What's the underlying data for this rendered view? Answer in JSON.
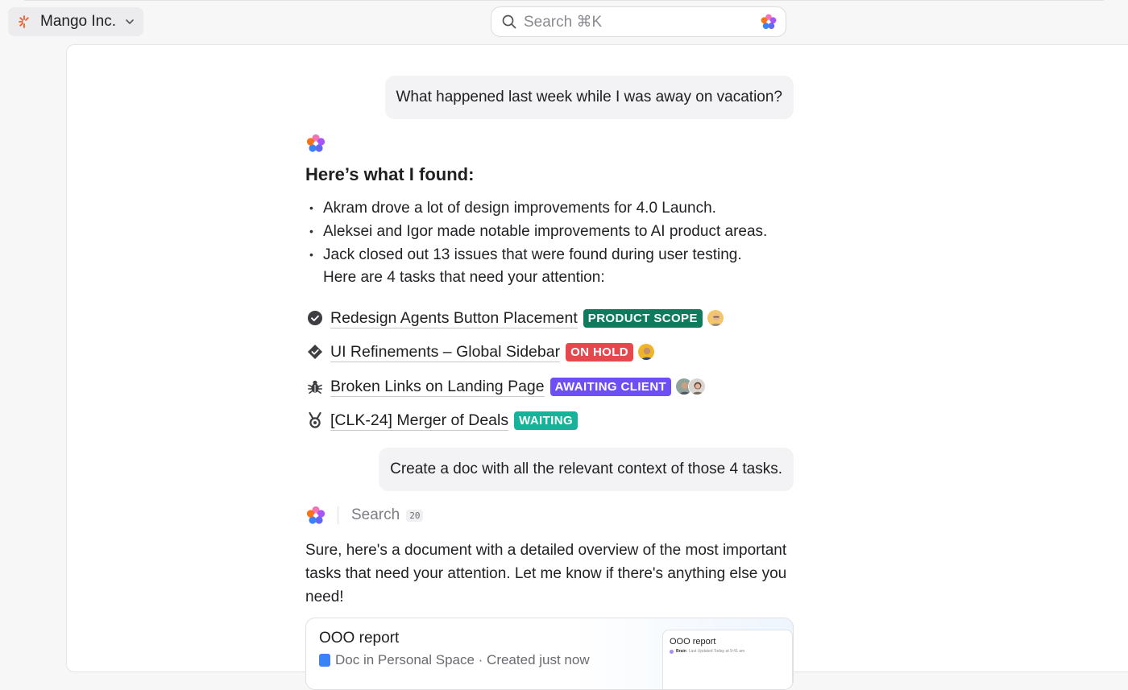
{
  "workspace": {
    "name": "Mango Inc."
  },
  "search": {
    "placeholder": "Search ⌘K"
  },
  "chat": {
    "user_message_1": "What happened last week while I was away on vacation?",
    "ai_heading": "Here’s what I found:",
    "bullets": [
      "Akram drove a lot of design improvements for 4.0 Launch.",
      "Aleksei and Igor made notable improvements to AI product areas.",
      "Jack closed out 13 issues that were found during user testing."
    ],
    "bullets_followup": "Here are 4 tasks that need your attention:",
    "tasks": [
      {
        "name": "Redesign Agents Button Placement",
        "icon": "check-circle-icon",
        "status": "PRODUCT SCOPE",
        "status_color": "#0f7a5c"
      },
      {
        "name": "UI Refinements – Global Sidebar",
        "icon": "diamond-check-icon",
        "status": "ON HOLD",
        "status_color": "#e5484d"
      },
      {
        "name": "Broken Links on Landing Page",
        "icon": "bug-icon",
        "status": "AWAITING CLIENT",
        "status_color": "#6e4ff5"
      },
      {
        "name": "[CLK-24] Merger of Deals",
        "icon": "medal-icon",
        "status": "WAITING",
        "status_color": "#16b39a"
      }
    ],
    "user_message_2": "Create a doc with all the relevant context of those 4 tasks.",
    "search_step": {
      "label": "Search",
      "count": "20"
    },
    "ai_answer": "Sure, here's a document with a detailed overview of the most important tasks that need your attention. Let me know if there's anything else you need!",
    "doc": {
      "title": "OOO report",
      "meta": "Doc in Personal Space · Created just now",
      "preview_title": "OOO report",
      "preview_author": "Brain",
      "preview_updated": "Last Updated Today at 9:41 am"
    }
  },
  "colors": {
    "accent_ai": "#8b5cf6",
    "panel_bg": "#ffffff",
    "page_bg": "#f7f7f8"
  }
}
